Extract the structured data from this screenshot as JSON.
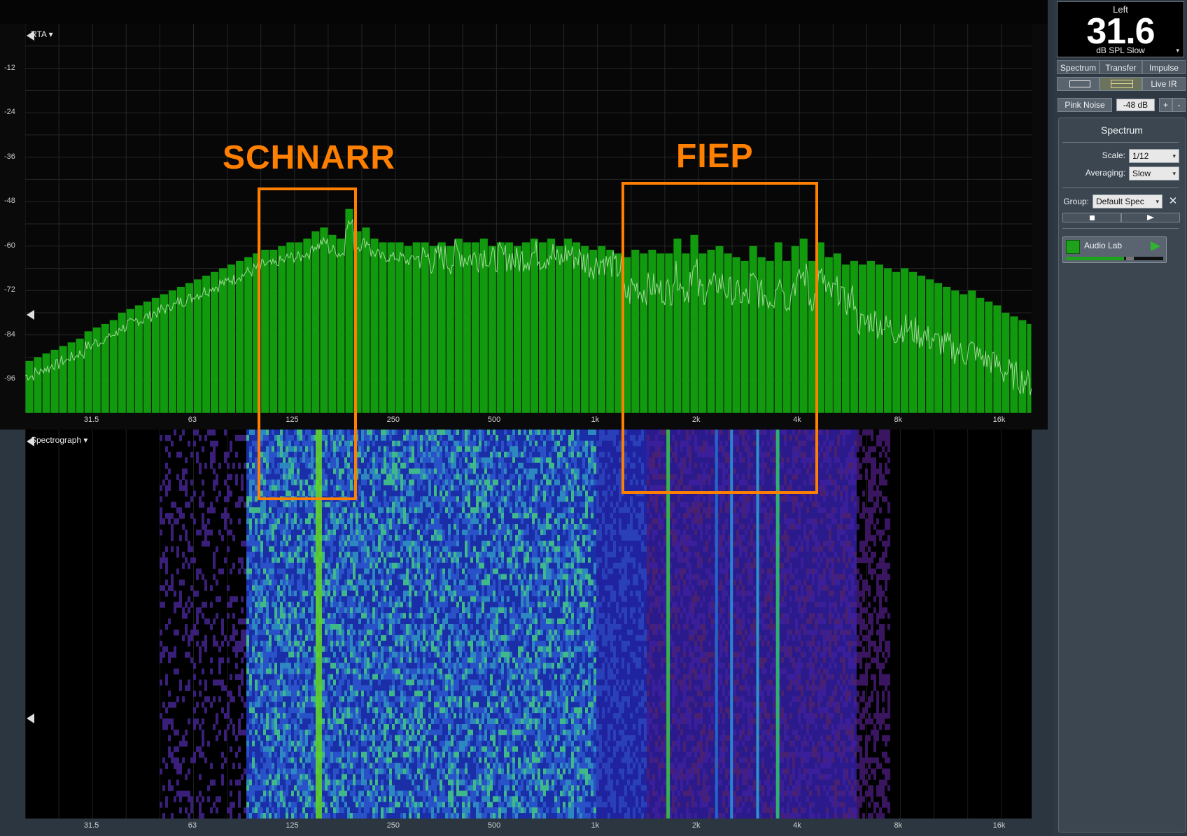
{
  "rta": {
    "menu_label": "RTA ▾",
    "y_ticks": [
      "-12",
      "-24",
      "-36",
      "-48",
      "-60",
      "-72",
      "-84",
      "-96"
    ],
    "x_ticks": [
      "31.5",
      "63",
      "125",
      "250",
      "500",
      "1k",
      "2k",
      "4k",
      "8k",
      "16k"
    ]
  },
  "spectrograph": {
    "menu_label": "Spectrograph ▾",
    "x_ticks": [
      "31.5",
      "63",
      "125",
      "250",
      "500",
      "1k",
      "2k",
      "4k",
      "8k",
      "16k"
    ]
  },
  "annotations": {
    "schnarr": "SCHNARR",
    "fiep": "FIEP"
  },
  "meter": {
    "channel": "Left",
    "value": "31.6",
    "unit": "dB SPL Slow"
  },
  "tabs": [
    "Spectrum",
    "Transfer",
    "Impulse"
  ],
  "view_controls": {
    "live_ir": "Live IR"
  },
  "generator": {
    "signal": "Pink Noise",
    "level": "-48 dB",
    "plus": "+",
    "minus": "-"
  },
  "sidebar": {
    "title": "Spectrum",
    "scale_label": "Scale:",
    "scale_value": "1/12",
    "averaging_label": "Averaging:",
    "averaging_value": "Slow",
    "group_label": "Group:",
    "group_value": "Default Spec",
    "source_name": "Audio Lab"
  },
  "colors": {
    "bar_green": "#129a0e",
    "annotation_orange": "#ff7f00",
    "source_green": "#1ea21e"
  },
  "chart_data": {
    "type": "bar",
    "ylim": [
      -105,
      0
    ],
    "xlim_hz": [
      20,
      20000
    ],
    "scale": "1/12 octave, log frequency",
    "series": [
      {
        "type": "bar",
        "x_hz_start": 20,
        "x_per_octave": 12,
        "values": [
          -91,
          -90,
          -89,
          -88,
          -87,
          -86,
          -85,
          -83,
          -82,
          -81,
          -80,
          -78,
          -77,
          -76,
          -75,
          -74,
          -73,
          -72,
          -71,
          -70,
          -69,
          -68,
          -67,
          -66,
          -65,
          -64,
          -63,
          -62,
          -61,
          -61,
          -60,
          -59,
          -59,
          -58,
          -56,
          -55,
          -57,
          -58,
          -50,
          -56,
          -55,
          -58,
          -59,
          -59,
          -59,
          -60,
          -59,
          -59,
          -60,
          -59,
          -60,
          -58,
          -59,
          -59,
          -58,
          -60,
          -59,
          -59,
          -60,
          -59,
          -58,
          -59,
          -58,
          -60,
          -58,
          -59,
          -60,
          -61,
          -60,
          -61,
          -62,
          -63,
          -61,
          -62,
          -61,
          -62,
          -62,
          -58,
          -62,
          -57,
          -62,
          -61,
          -60,
          -62,
          -63,
          -64,
          -60,
          -63,
          -64,
          -59,
          -64,
          -60,
          -58,
          -64,
          -59,
          -63,
          -62,
          -65,
          -64,
          -65,
          -64,
          -65,
          -66,
          -67,
          -66,
          -67,
          -68,
          -69,
          -70,
          -71,
          -72,
          -73,
          -72,
          -74,
          -75,
          -76,
          -78,
          -79,
          -80,
          -81,
          -82,
          -83,
          -84,
          -85
        ]
      },
      {
        "type": "line",
        "name": "fine resolution",
        "description_free": true
      }
    ]
  }
}
